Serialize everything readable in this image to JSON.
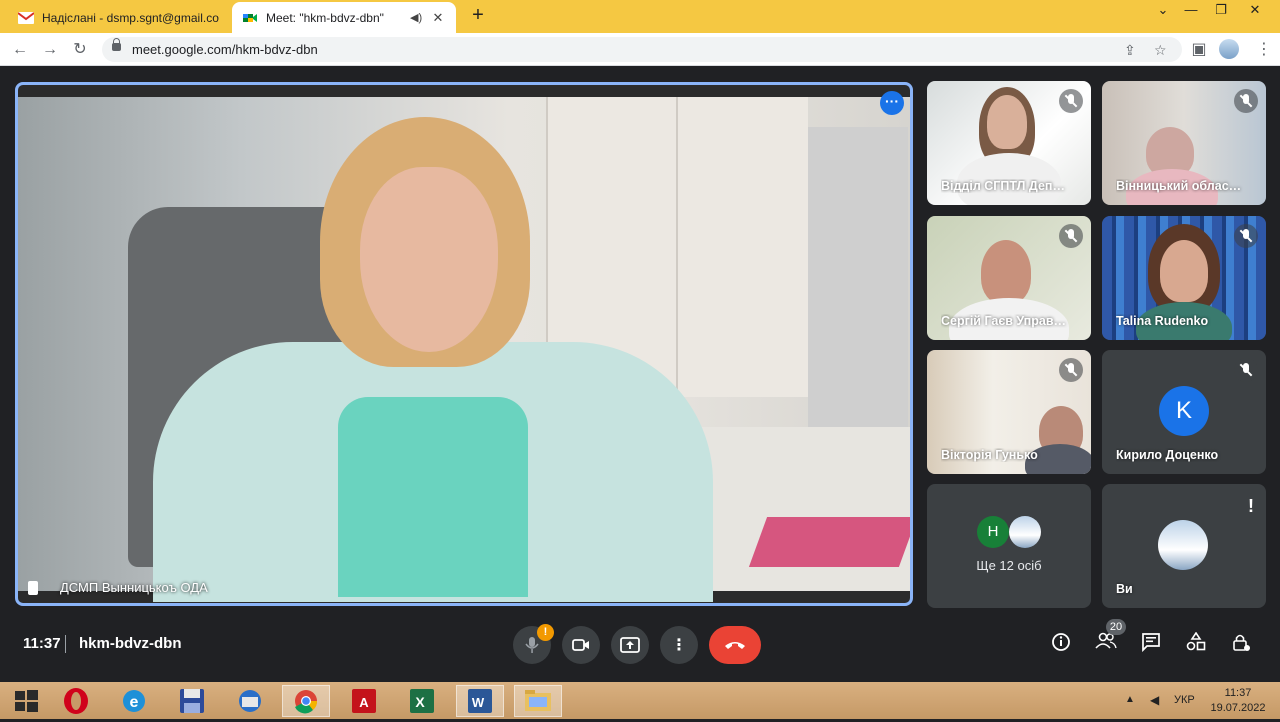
{
  "browser": {
    "tabs": [
      {
        "title": "Надіслані - dsmp.sgnt@gmail.co",
        "favicon": "gmail-icon",
        "active": false
      },
      {
        "title": "Meet: \"hkm-bdvz-dbn\"",
        "favicon": "google-meet-icon",
        "active": true
      }
    ],
    "url": "meet.google.com/hkm-bdvz-dbn",
    "accent_color": "#f5c842"
  },
  "main_speaker": {
    "name": "ДСМП Вынницькоъ ОДА"
  },
  "participants": [
    {
      "name": "Відділ СГПТЛ Деп…",
      "muted": true
    },
    {
      "name": "Вінницький облас…",
      "muted": true
    },
    {
      "name": "Сергій Гаєв Управ…",
      "muted": true
    },
    {
      "name": "Talina Rudenko",
      "muted": true
    },
    {
      "name": "Вікторія Гунько",
      "muted": true
    },
    {
      "name": "Кирило Доценко",
      "muted": true,
      "avatar_letter": "K",
      "avatar_color": "#1a73e8"
    },
    {
      "name": "Ще 12 осіб",
      "avatar_letter": "Н",
      "avatar_color": "#188038"
    },
    {
      "name": "Ви",
      "alert": "!"
    }
  ],
  "controls": {
    "time": "11:37",
    "meeting_code": "hkm-bdvz-dbn",
    "mic_warning": "!",
    "people_count": "20",
    "leave_color": "#ea4335"
  },
  "taskbar": {
    "language": "УКР",
    "time": "11:37",
    "date": "19.07.2022"
  }
}
